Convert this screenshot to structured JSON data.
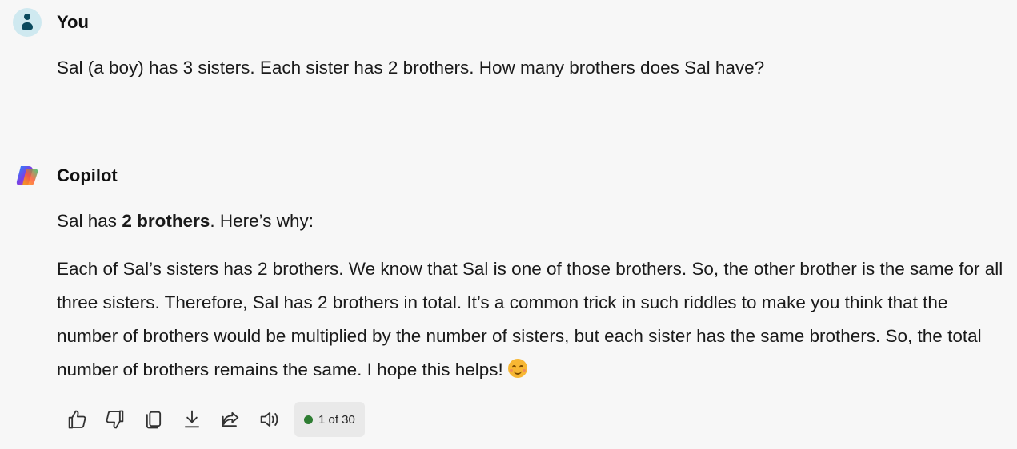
{
  "user_message": {
    "author": "You",
    "text": "Sal (a boy) has 3 sisters. Each sister has 2 brothers. How many brothers does Sal have?"
  },
  "copilot_message": {
    "author": "Copilot",
    "answer_prefix": "Sal has ",
    "answer_bold": "2 brothers",
    "answer_suffix": ". Here’s why:",
    "paragraph": "Each of Sal’s sisters has 2 brothers. We know that Sal is one of those brothers. So, the other brother is the same for all three sisters. Therefore, Sal has 2 brothers in total. It’s a common trick in such riddles to make you think that the number of brothers would be multiplied by the number of sisters, but each sister has the same brothers. So, the total number of brothers remains the same. I hope this helps!",
    "emoji": "smiling-face-emoji"
  },
  "actions": {
    "icons": [
      "thumbs-up-icon",
      "thumbs-down-icon",
      "copy-icon",
      "download-icon",
      "share-icon",
      "read-aloud-icon"
    ],
    "counter_text": "1 of 30",
    "counter_dot_color": "#2e7d32"
  },
  "colors": {
    "background": "#f7f7f7",
    "user_avatar_bg": "#cfe9f0",
    "user_avatar_fg": "#0a4a5e"
  }
}
